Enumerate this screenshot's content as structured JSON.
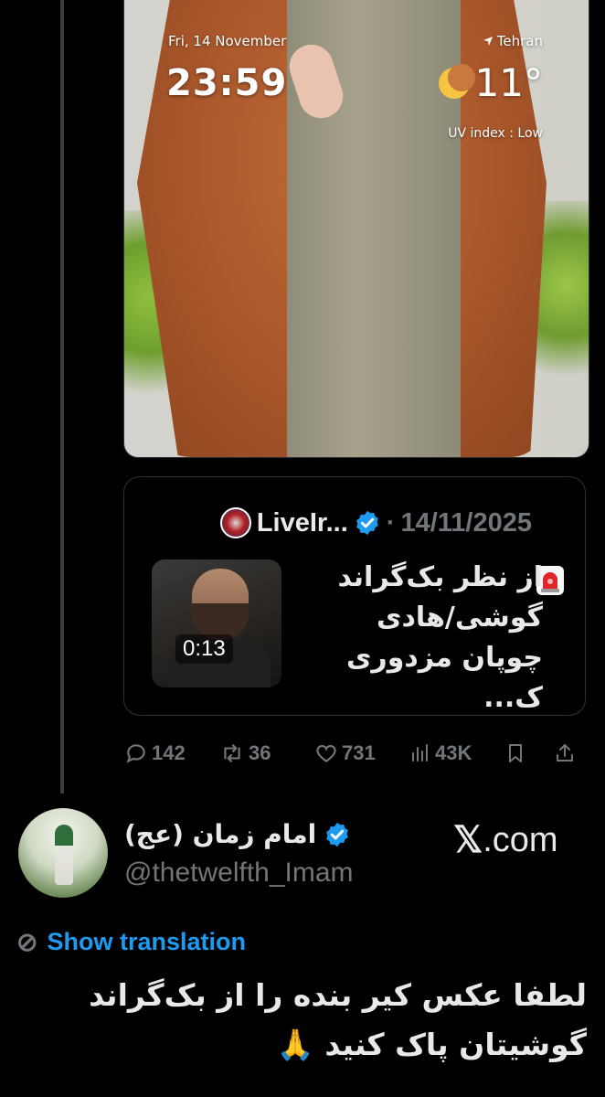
{
  "wallpaper": {
    "date": "Fri, 14 November",
    "time": "23:59",
    "location": "Tehran",
    "temperature": "11°",
    "uv": "UV index : Low"
  },
  "quote": {
    "author": "LiveIr...",
    "separator": "·",
    "date": "14/11/2025",
    "text": "از نظر بک‌گراند گوشی/هادی چوپان مزدوری ک...",
    "video_duration": "0:13"
  },
  "stats": {
    "replies": "142",
    "reposts": "36",
    "likes": "731",
    "views": "43K"
  },
  "reply": {
    "name": "امام زمان (عج)",
    "handle": "@thetwelfth_Imam",
    "site": ".com",
    "translate": "Show translation",
    "text": "لطفا عکس کیر بنده را از بک‌گراند گوشیتان پاک کنید 🙏"
  },
  "colors": {
    "accent": "#1d9bf0",
    "muted": "#71767b",
    "text": "#e7e9ea",
    "background": "#000000"
  },
  "icons": [
    "verified-icon",
    "reply-icon",
    "repost-icon",
    "like-icon",
    "views-icon",
    "bookmark-icon",
    "share-icon",
    "siren-icon",
    "location-icon",
    "moon-icon",
    "translate-icon",
    "x-logo-icon"
  ]
}
